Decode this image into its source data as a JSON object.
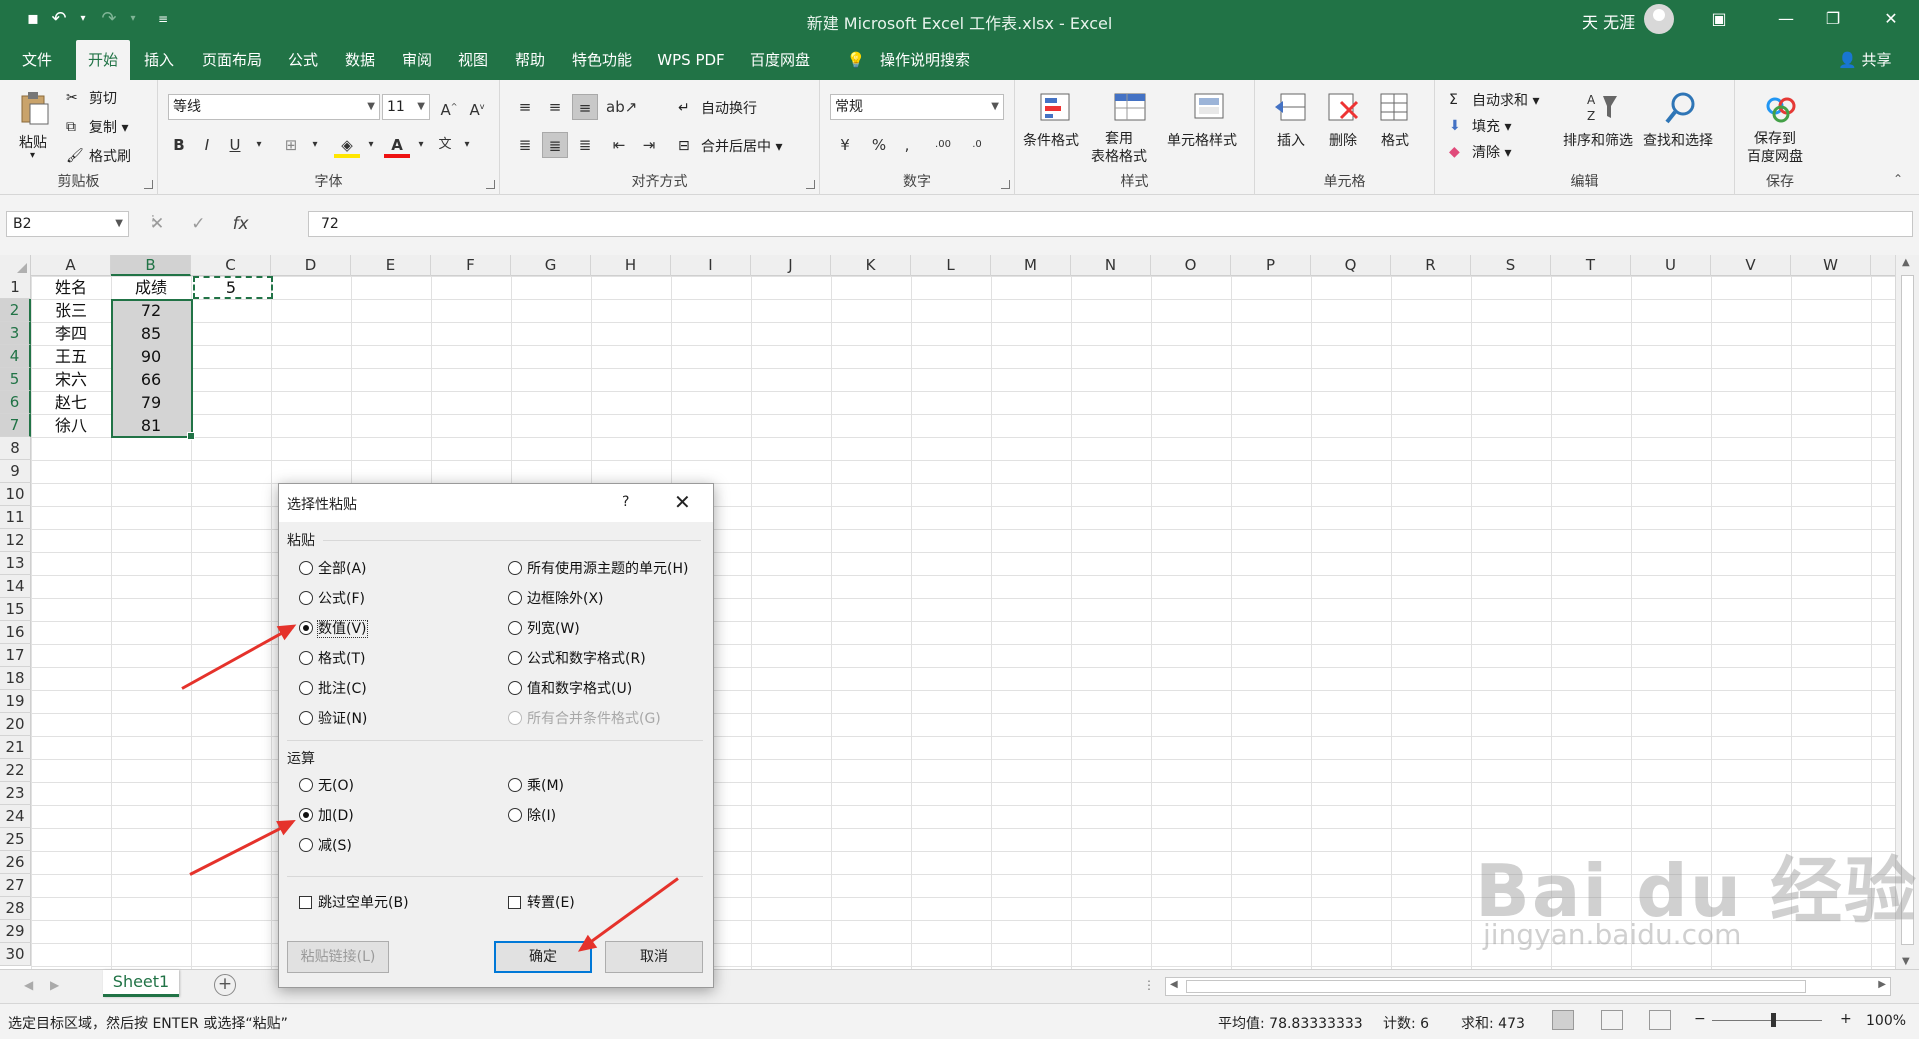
{
  "title_bar": {
    "title": "新建 Microsoft Excel 工作表.xlsx  -  Excel",
    "user": "天 无涯"
  },
  "menu_tabs": [
    "文件",
    "开始",
    "插入",
    "页面布局",
    "公式",
    "数据",
    "审阅",
    "视图",
    "帮助",
    "特色功能",
    "WPS PDF",
    "百度网盘"
  ],
  "active_tab": "开始",
  "tell_me": "操作说明搜索",
  "share": "共享",
  "ribbon": {
    "clipboard": {
      "paste": "粘贴",
      "cut": "剪切",
      "copy": "复制",
      "painter": "格式刷",
      "label": "剪贴板"
    },
    "font": {
      "name": "等线",
      "size": "11",
      "label": "字体",
      "bold": "B",
      "italic": "I",
      "underline": "U"
    },
    "alignment": {
      "wrap": "自动换行",
      "merge": "合并后居中",
      "label": "对齐方式"
    },
    "number": {
      "format": "常规",
      "label": "数字"
    },
    "styles": {
      "conditional": "条件格式",
      "table": "套用\n表格格式",
      "cell": "单元格样式",
      "label": "样式"
    },
    "cells": {
      "insert": "插入",
      "delete": "删除",
      "format": "格式",
      "label": "单元格"
    },
    "editing": {
      "autosum": "自动求和",
      "fill": "填充",
      "clear": "清除",
      "sort": "排序和筛选",
      "find": "查找和选择",
      "label": "编辑"
    },
    "save": {
      "button": "保存到\n百度网盘",
      "label": "保存"
    }
  },
  "formula_bar": {
    "name_box": "B2",
    "formula": "72",
    "fx": "fx"
  },
  "columns": [
    "A",
    "B",
    "C",
    "D",
    "E",
    "F",
    "G",
    "H",
    "I",
    "J",
    "K",
    "L",
    "M",
    "N",
    "O",
    "P",
    "Q",
    "R",
    "S",
    "T",
    "U",
    "V",
    "W"
  ],
  "rows": [
    "1",
    "2",
    "3",
    "4",
    "5",
    "6",
    "7",
    "8",
    "9",
    "10",
    "11",
    "12",
    "13",
    "14",
    "15",
    "16",
    "17",
    "18",
    "19",
    "20",
    "21",
    "22",
    "23",
    "24",
    "25",
    "26",
    "27",
    "28",
    "29",
    "30"
  ],
  "cells": {
    "A": [
      "姓名",
      "张三",
      "李四",
      "王五",
      "宋六",
      "赵七",
      "徐八"
    ],
    "B": [
      "成绩",
      "72",
      "85",
      "90",
      "66",
      "79",
      "81"
    ],
    "C1": "5"
  },
  "sheet_tab": "Sheet1",
  "status": {
    "message": "选定目标区域，然后按 ENTER 或选择“粘贴”",
    "average": "平均值: 78.83333333",
    "count": "计数: 6",
    "sum": "求和: 473",
    "zoom": "100%"
  },
  "dialog": {
    "title": "选择性粘贴",
    "help": "?",
    "close": "✕",
    "paste_section": "粘贴",
    "paste_options_left": [
      "全部(A)",
      "公式(F)",
      "数值(V)",
      "格式(T)",
      "批注(C)",
      "验证(N)"
    ],
    "paste_options_right": [
      "所有使用源主题的单元(H)",
      "边框除外(X)",
      "列宽(W)",
      "公式和数字格式(R)",
      "值和数字格式(U)",
      "所有合并条件格式(G)"
    ],
    "paste_selected": "数值(V)",
    "operation_section": "运算",
    "operation_left": [
      "无(O)",
      "加(D)",
      "减(S)"
    ],
    "operation_right": [
      "乘(M)",
      "除(I)"
    ],
    "operation_selected": "加(D)",
    "skip_blanks": "跳过空单元(B)",
    "transpose": "转置(E)",
    "paste_link": "粘贴链接(L)",
    "ok": "确定",
    "cancel": "取消"
  },
  "watermark": {
    "brand": "Bai du 经验",
    "url": "jingyan.baidu.com"
  },
  "colors": {
    "excel_green": "#217346",
    "annotation_red": "#e5322b",
    "dialog_focus": "#0078d7"
  }
}
